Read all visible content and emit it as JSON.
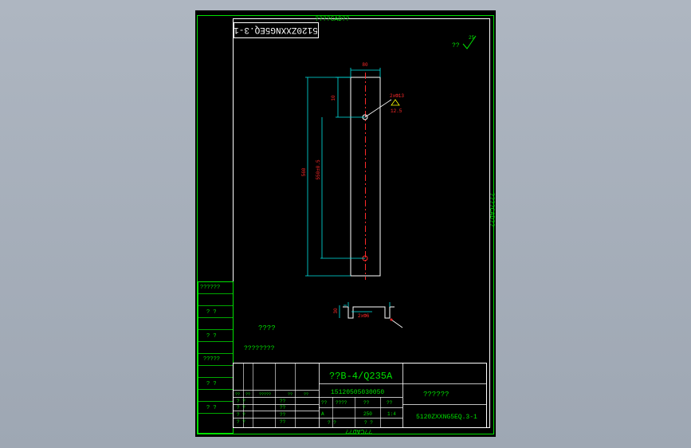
{
  "window": {
    "top_title": "????CAD??",
    "bottom_title": "??CAD??",
    "side_title": "????CAD??"
  },
  "drawing": {
    "stamp_mirrored": "5120ZXXNG5EQ.3-1",
    "roughness_label": "??",
    "roughness_value": "25",
    "dims": {
      "width_top": "80",
      "top_offset": "10",
      "hole_spec": "2xΦ13",
      "hole_roughness": "12.5",
      "length_total": "560",
      "length_inner": "550±0.5",
      "section_height": "30",
      "section_spec": "2xΦ6"
    },
    "notes": {
      "tech_title": "????",
      "tech_body": "????????"
    }
  },
  "side_table": {
    "rows": [
      "??????",
      "? ?",
      "? ?",
      "?????",
      "? ?",
      "? ?"
    ]
  },
  "title_block": {
    "material": "??B-4/Q235A",
    "part_code": "15120505030050",
    "part_name": "??????",
    "drawing_no": "5120ZXXNG5EQ.3-1",
    "header_cells": [
      "??",
      "??",
      "?????",
      "??",
      "??"
    ],
    "sub_cells": [
      "??",
      "????",
      "??",
      "??"
    ],
    "values": [
      "A",
      "250",
      "1:4"
    ],
    "left_rows": [
      "? ?",
      "? ?",
      "? ?",
      "? ?"
    ],
    "left_vals": [
      "??",
      "??",
      "??",
      "??"
    ],
    "bottom_cells": [
      "? ?",
      "? ?"
    ]
  }
}
